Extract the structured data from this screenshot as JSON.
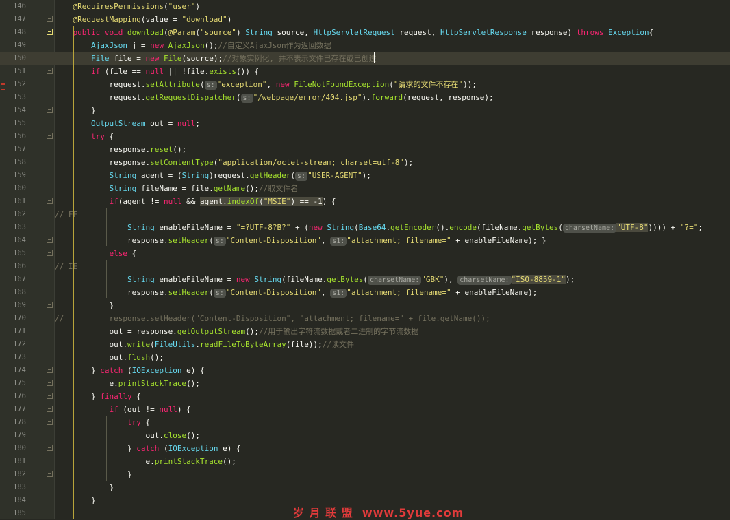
{
  "editor": {
    "watermark": "岁 月 联 盟  www.5yue.com",
    "lines": [
      {
        "num": "146",
        "segs": [
          [
            "a",
            "    @RequiresPermissions"
          ],
          [
            "p",
            "("
          ],
          [
            "s",
            "\"user\""
          ],
          [
            "p",
            ")"
          ]
        ]
      },
      {
        "num": "147",
        "segs": [
          [
            "a",
            "    @RequestMapping"
          ],
          [
            "p",
            "(value = "
          ],
          [
            "s",
            "\"download\""
          ],
          [
            "p",
            ")"
          ]
        ]
      },
      {
        "num": "148",
        "segs": [
          [
            "k",
            "    public void "
          ],
          [
            "f",
            "download"
          ],
          [
            "p",
            "("
          ],
          [
            "a",
            "@Param"
          ],
          [
            "p",
            "("
          ],
          [
            "s",
            "\"source\""
          ],
          [
            "p",
            ") "
          ],
          [
            "t",
            "String"
          ],
          [
            "p",
            " source, "
          ],
          [
            "t",
            "HttpServletRequest"
          ],
          [
            "p",
            " request, "
          ],
          [
            "t",
            "HttpServletResponse"
          ],
          [
            "p",
            " response) "
          ],
          [
            "k",
            "throws "
          ],
          [
            "t",
            "Exception"
          ],
          [
            "p",
            "{"
          ]
        ]
      },
      {
        "num": "149",
        "segs": [
          [
            "t",
            "        AjaxJson"
          ],
          [
            "p",
            " j = "
          ],
          [
            "k",
            "new "
          ],
          [
            "f",
            "AjaxJson"
          ],
          [
            "p",
            "();"
          ],
          [
            "c",
            "//自定义AjaxJson作为返回数据"
          ]
        ]
      },
      {
        "num": "150",
        "segs": [
          [
            "t",
            "        File"
          ],
          [
            "p",
            " file = "
          ],
          [
            "k",
            "new "
          ],
          [
            "f",
            "File"
          ],
          [
            "p",
            "(source);"
          ],
          [
            "c",
            "//对象实例化, 并不表示文件已存在或已创建"
          ]
        ]
      },
      {
        "num": "151",
        "segs": [
          [
            "k",
            "        if "
          ],
          [
            "p",
            "(file == "
          ],
          [
            "k",
            "null"
          ],
          [
            "p",
            " || !file."
          ],
          [
            "f",
            "exists"
          ],
          [
            "p",
            "()) {"
          ]
        ]
      },
      {
        "num": "152",
        "segs": [
          [
            "p",
            "            request."
          ],
          [
            "f",
            "setAttribute"
          ],
          [
            "p",
            "("
          ],
          [
            "h",
            "s:"
          ],
          [
            "s",
            "\"exception\""
          ],
          [
            "p",
            ", "
          ],
          [
            "k",
            "new "
          ],
          [
            "f",
            "FileNotFoundException"
          ],
          [
            "p",
            "("
          ],
          [
            "s",
            "\"请求的文件不存在\""
          ],
          [
            "p",
            "));"
          ]
        ]
      },
      {
        "num": "153",
        "segs": [
          [
            "p",
            "            request."
          ],
          [
            "f",
            "getRequestDispatcher"
          ],
          [
            "p",
            "("
          ],
          [
            "h",
            "s:"
          ],
          [
            "s",
            "\"/webpage/error/404.jsp\""
          ],
          [
            "p",
            ")."
          ],
          [
            "f",
            "forward"
          ],
          [
            "p",
            "(request, response);"
          ]
        ]
      },
      {
        "num": "154",
        "segs": [
          [
            "p",
            "        }"
          ]
        ]
      },
      {
        "num": "155",
        "segs": [
          [
            "t",
            "        OutputStream"
          ],
          [
            "p",
            " out = "
          ],
          [
            "k",
            "null"
          ],
          [
            "p",
            ";"
          ]
        ]
      },
      {
        "num": "156",
        "segs": [
          [
            "k",
            "        try "
          ],
          [
            "p",
            "{"
          ]
        ]
      },
      {
        "num": "157",
        "segs": [
          [
            "p",
            "            response."
          ],
          [
            "f",
            "reset"
          ],
          [
            "p",
            "();"
          ]
        ]
      },
      {
        "num": "158",
        "segs": [
          [
            "p",
            "            response."
          ],
          [
            "f",
            "setContentType"
          ],
          [
            "p",
            "("
          ],
          [
            "s",
            "\"application/octet-stream; charset=utf-8\""
          ],
          [
            "p",
            ");"
          ]
        ]
      },
      {
        "num": "159",
        "segs": [
          [
            "t",
            "            String"
          ],
          [
            "p",
            " agent = ("
          ],
          [
            "t",
            "String"
          ],
          [
            "p",
            ")request."
          ],
          [
            "f",
            "getHeader"
          ],
          [
            "p",
            "("
          ],
          [
            "h",
            "s:"
          ],
          [
            "s",
            "\"USER-AGENT\""
          ],
          [
            "p",
            ");"
          ]
        ]
      },
      {
        "num": "160",
        "segs": [
          [
            "t",
            "            String"
          ],
          [
            "p",
            " fileName = file."
          ],
          [
            "f",
            "getName"
          ],
          [
            "p",
            "();"
          ],
          [
            "c",
            "//取文件名"
          ]
        ]
      },
      {
        "num": "161",
        "segs": [
          [
            "k",
            "            if"
          ],
          [
            "p",
            "(agent != "
          ],
          [
            "k",
            "null"
          ],
          [
            "p",
            " && "
          ],
          [
            "m",
            "agent."
          ],
          [
            "mf",
            "indexOf"
          ],
          [
            "m",
            "("
          ],
          [
            "ms",
            "\"MSIE\""
          ],
          [
            "m",
            ") == -1"
          ],
          [
            "p",
            ") {"
          ]
        ]
      },
      {
        "num": "162",
        "segs": [
          [
            "c",
            "// FF"
          ]
        ]
      },
      {
        "num": "163",
        "segs": [
          [
            "t",
            "                String"
          ],
          [
            "p",
            " enableFileName = "
          ],
          [
            "s",
            "\"=?UTF-8?B?\""
          ],
          [
            "p",
            " + ("
          ],
          [
            "k",
            "new "
          ],
          [
            "t",
            "String"
          ],
          [
            "p",
            "("
          ],
          [
            "t",
            "Base64"
          ],
          [
            "p",
            "."
          ],
          [
            "f",
            "getEncoder"
          ],
          [
            "p",
            "()."
          ],
          [
            "f",
            "encode"
          ],
          [
            "p",
            "(fileName."
          ],
          [
            "f",
            "getBytes"
          ],
          [
            "p",
            "("
          ],
          [
            "h",
            "charsetName:"
          ],
          [
            "ms",
            "\"UTF-8\""
          ],
          [
            "p",
            "))))"
          ],
          [
            "p",
            " + "
          ],
          [
            "s",
            "\"?=\""
          ],
          [
            "p",
            ";"
          ]
        ]
      },
      {
        "num": "164",
        "segs": [
          [
            "p",
            "                response."
          ],
          [
            "f",
            "setHeader"
          ],
          [
            "p",
            "("
          ],
          [
            "h",
            "s:"
          ],
          [
            "s",
            "\"Content-Disposition\""
          ],
          [
            "p",
            ", "
          ],
          [
            "h",
            "s1:"
          ],
          [
            "s",
            "\"attachment; filename=\""
          ],
          [
            "p",
            " + enableFileName); }"
          ]
        ]
      },
      {
        "num": "165",
        "segs": [
          [
            "k",
            "            else "
          ],
          [
            "p",
            "{"
          ]
        ]
      },
      {
        "num": "166",
        "segs": [
          [
            "c",
            "// IE"
          ]
        ]
      },
      {
        "num": "167",
        "segs": [
          [
            "t",
            "                String"
          ],
          [
            "p",
            " enableFileName = "
          ],
          [
            "k",
            "new "
          ],
          [
            "t",
            "String"
          ],
          [
            "p",
            "(fileName."
          ],
          [
            "f",
            "getBytes"
          ],
          [
            "p",
            "("
          ],
          [
            "h",
            "charsetName:"
          ],
          [
            "s",
            "\"GBK\""
          ],
          [
            "p",
            "), "
          ],
          [
            "h",
            "charsetName:"
          ],
          [
            "ms",
            "\"ISO-8859-1\""
          ],
          [
            "p",
            ");"
          ]
        ]
      },
      {
        "num": "168",
        "segs": [
          [
            "p",
            "                response."
          ],
          [
            "f",
            "setHeader"
          ],
          [
            "p",
            "("
          ],
          [
            "h",
            "s:"
          ],
          [
            "s",
            "\"Content-Disposition\""
          ],
          [
            "p",
            ", "
          ],
          [
            "h",
            "s1:"
          ],
          [
            "s",
            "\"attachment; filename=\""
          ],
          [
            "p",
            " + enableFileName);"
          ]
        ]
      },
      {
        "num": "169",
        "segs": [
          [
            "p",
            "            }"
          ]
        ]
      },
      {
        "num": "170",
        "segs": [
          [
            "c",
            "//          response.setHeader(\"Content-Disposition\", \"attachment; filename=\" + file.getName());"
          ]
        ]
      },
      {
        "num": "171",
        "segs": [
          [
            "p",
            "            out = response."
          ],
          [
            "f",
            "getOutputStream"
          ],
          [
            "p",
            "();"
          ],
          [
            "c",
            "//用于输出字符流数据或者二进制的字节流数据"
          ]
        ]
      },
      {
        "num": "172",
        "segs": [
          [
            "p",
            "            out."
          ],
          [
            "f",
            "write"
          ],
          [
            "p",
            "("
          ],
          [
            "t",
            "FileUtils"
          ],
          [
            "p",
            "."
          ],
          [
            "f",
            "readFileToByteArray"
          ],
          [
            "p",
            "(file));"
          ],
          [
            "c",
            "//读文件"
          ]
        ]
      },
      {
        "num": "173",
        "segs": [
          [
            "p",
            "            out."
          ],
          [
            "f",
            "flush"
          ],
          [
            "p",
            "();"
          ]
        ]
      },
      {
        "num": "174",
        "segs": [
          [
            "p",
            "        } "
          ],
          [
            "k",
            "catch "
          ],
          [
            "p",
            "("
          ],
          [
            "t",
            "IOException"
          ],
          [
            "p",
            " e) {"
          ]
        ]
      },
      {
        "num": "175",
        "segs": [
          [
            "p",
            "            e."
          ],
          [
            "f",
            "printStackTrace"
          ],
          [
            "p",
            "();"
          ]
        ]
      },
      {
        "num": "176",
        "segs": [
          [
            "p",
            "        } "
          ],
          [
            "k",
            "finally "
          ],
          [
            "p",
            "{"
          ]
        ]
      },
      {
        "num": "177",
        "segs": [
          [
            "k",
            "            if "
          ],
          [
            "p",
            "(out != "
          ],
          [
            "k",
            "null"
          ],
          [
            "p",
            ") {"
          ]
        ]
      },
      {
        "num": "178",
        "segs": [
          [
            "k",
            "                try "
          ],
          [
            "p",
            "{"
          ]
        ]
      },
      {
        "num": "179",
        "segs": [
          [
            "p",
            "                    out."
          ],
          [
            "f",
            "close"
          ],
          [
            "p",
            "();"
          ]
        ]
      },
      {
        "num": "180",
        "segs": [
          [
            "p",
            "                } "
          ],
          [
            "k",
            "catch "
          ],
          [
            "p",
            "("
          ],
          [
            "t",
            "IOException"
          ],
          [
            "p",
            " e) {"
          ]
        ]
      },
      {
        "num": "181",
        "segs": [
          [
            "p",
            "                    e."
          ],
          [
            "f",
            "printStackTrace"
          ],
          [
            "p",
            "();"
          ]
        ]
      },
      {
        "num": "182",
        "segs": [
          [
            "p",
            "                }"
          ]
        ]
      },
      {
        "num": "183",
        "segs": [
          [
            "p",
            "            }"
          ]
        ]
      },
      {
        "num": "184",
        "segs": [
          [
            "p",
            "        }"
          ]
        ]
      },
      {
        "num": "185",
        "segs": [
          [
            "p",
            ""
          ]
        ]
      }
    ]
  }
}
